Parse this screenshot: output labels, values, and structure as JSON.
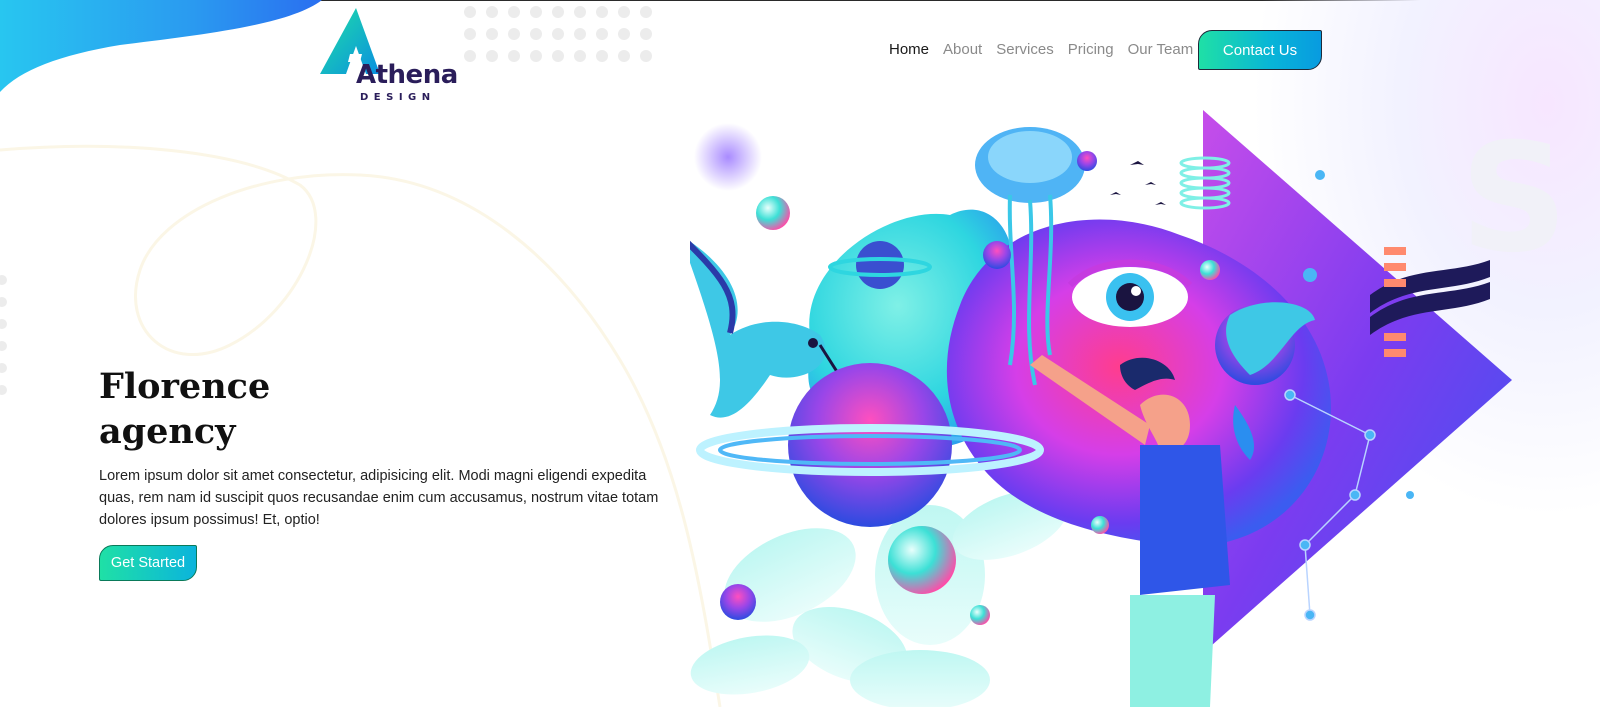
{
  "brand": {
    "name": "Athena",
    "tagline": "DESIGN"
  },
  "nav": {
    "items": [
      {
        "label": "Home",
        "active": true
      },
      {
        "label": "About",
        "active": false
      },
      {
        "label": "Services",
        "active": false
      },
      {
        "label": "Pricing",
        "active": false
      },
      {
        "label": "Our Team",
        "active": false
      }
    ],
    "contact_label": "Contact Us"
  },
  "hero": {
    "title_line1": "Florence",
    "title_line2": "agency",
    "body": "Lorem ipsum dolor sit amet consectetur, adipisicing elit. Modi magni eligendi expedita quas, rem nam id suscipit quos recusandae enim cum accusamus, nostrum vitae totam dolores ipsum possimus! Et, optio!",
    "cta_label": "Get Started"
  },
  "colors": {
    "accent_start": "#1fe0a6",
    "accent_end": "#089be0",
    "brand_dark": "#2a1d5a",
    "illustration_purple": "#7b3cf0",
    "illustration_pink": "#ff3d8e"
  },
  "icons": {
    "logo": "athena-a-logo-icon",
    "hero_art": "space-surreal-illustration"
  }
}
